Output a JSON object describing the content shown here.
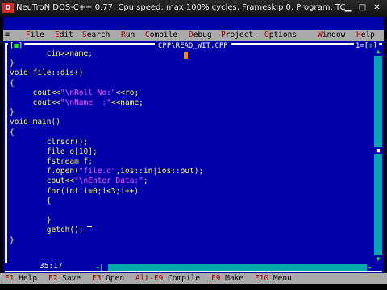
{
  "window": {
    "title": "NeuTroN DOS-C++ 0.77, Cpu speed: max 100% cycles, Frameskip  0, Program:    TC",
    "app_icon": "dosbox-icon",
    "buttons": [
      "minimize",
      "maximize",
      "close"
    ],
    "button_glyphs": {
      "minimize": "▁",
      "maximize": "□",
      "close": "✕"
    }
  },
  "menubar": {
    "system": "≡",
    "items": [
      {
        "hot": "F",
        "rest": "ile"
      },
      {
        "hot": "E",
        "rest": "dit"
      },
      {
        "hot": "S",
        "rest": "earch"
      },
      {
        "hot": "R",
        "rest": "un"
      },
      {
        "hot": "C",
        "rest": "ompile"
      },
      {
        "hot": "D",
        "rest": "ebug"
      },
      {
        "hot": "P",
        "rest": "roject"
      },
      {
        "hot": "O",
        "rest": "ptions"
      },
      {
        "hot": "W",
        "rest": "indow"
      },
      {
        "hot": "H",
        "rest": "elp"
      }
    ]
  },
  "editor": {
    "close_box_left": "[",
    "close_box_mark": "■",
    "close_box_right": "]",
    "file_title": "CPP\\READ_WIT.CPP",
    "window_number": "1=[",
    "window_arrow": "↕",
    "window_number_end": "]",
    "lines": [
      [
        {
          "t": "        cin>>name;"
        }
      ],
      [
        {
          "t": "}"
        }
      ],
      [
        {
          "t": "void file::dis()"
        }
      ],
      [
        {
          "t": "{"
        }
      ],
      [
        {
          "t": "     cout<<"
        },
        {
          "t": "\"\\nRoll No:\"",
          "s": 1
        },
        {
          "t": "<<ro;"
        }
      ],
      [
        {
          "t": "     cout<<"
        },
        {
          "t": "\"\\nName  :\"",
          "s": 1
        },
        {
          "t": "<<name;"
        }
      ],
      [
        {
          "t": "}"
        }
      ],
      [
        {
          "t": "void main()"
        }
      ],
      [
        {
          "t": "{"
        }
      ],
      [
        {
          "t": "        clrscr();"
        }
      ],
      [
        {
          "t": "        file o[10];"
        }
      ],
      [
        {
          "t": "        fstream f;"
        }
      ],
      [
        {
          "t": "        f.open("
        },
        {
          "t": "\"file.c\"",
          "s": 1
        },
        {
          "t": ",ios::in|ios::out);"
        }
      ],
      [
        {
          "t": "        cout<<"
        },
        {
          "t": "\"\\nEnter Data:\"",
          "s": 1
        },
        {
          "t": ";"
        }
      ],
      [
        {
          "t": "        for(int i=0;i<3;i++)"
        }
      ],
      [
        {
          "t": "        {"
        }
      ],
      [
        {
          "t": ""
        }
      ],
      [
        {
          "t": "        }"
        }
      ],
      [
        {
          "t": "        getch();"
        }
      ],
      [
        {
          "t": "}"
        }
      ]
    ],
    "cursor_position": "35:17",
    "scroll_up": "▲",
    "scroll_down": "▼",
    "scroll_thumb": "■",
    "hscroll_left": "◄",
    "hscroll_right": "►"
  },
  "hotkeys": [
    {
      "key": "F1",
      "label": " Help"
    },
    {
      "key": "F2",
      "label": " Save"
    },
    {
      "key": "F3",
      "label": " Open"
    },
    {
      "key": "Alt-F9",
      "label": " Compile"
    },
    {
      "key": "F9",
      "label": " Make"
    },
    {
      "key": "F10",
      "label": " Menu"
    }
  ],
  "colors": {
    "editor_bg": "#0000aa",
    "code_text": "#ffff55",
    "string_literal": "#ff55ff",
    "menu_bg": "#aaaaaa",
    "hotkey_red": "#aa0000"
  }
}
